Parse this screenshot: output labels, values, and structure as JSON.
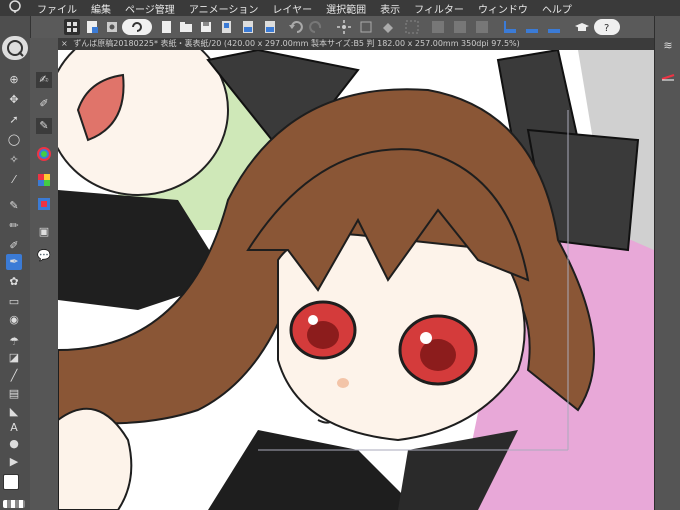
{
  "menubar": {
    "app_icon": "tablet-app-icon",
    "items": [
      "ファイル",
      "編集",
      "ページ管理",
      "アニメーション",
      "レイヤー",
      "選択範囲",
      "表示",
      "フィルター",
      "ウィンドウ",
      "ヘルプ"
    ]
  },
  "document_tab": {
    "title": "ずんば原稿20180225* 表紙・裏表紙/20 (420.00 x 297.00mm 製本サイズ:B5 判 182.00 x 257.00mm 350dpi 97.5%)"
  },
  "command_bar": {
    "icons": [
      "menu-grid-icon",
      "new-document-icon",
      "settings-icon",
      "logo-icon",
      "new-file-icon",
      "open-folder-icon",
      "save-icon",
      "page-icon",
      "export-icon",
      "export-2-icon",
      "undo-icon",
      "redo-icon",
      "sparkle-icon",
      "transform-icon",
      "fill-icon",
      "deselect-icon",
      "grid-icon",
      "ruler-icon",
      "ruler-2-icon",
      "ruler-3-icon",
      "graduation-cap-icon",
      "help-icon"
    ]
  },
  "colors": {
    "menubar_bg": "#3a3a3a",
    "panel_bg": "#555555",
    "accent_blue": "#3b7bd6",
    "hair": "#8a5636",
    "eye": "#d43b3b"
  }
}
